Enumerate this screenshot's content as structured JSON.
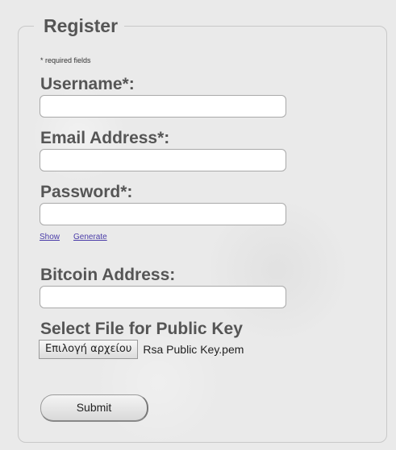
{
  "form": {
    "legend": "Register",
    "required_note": "* required fields",
    "username": {
      "label": "Username*:",
      "value": ""
    },
    "email": {
      "label": "Email Address*:",
      "value": ""
    },
    "password": {
      "label": "Password*:",
      "value": ""
    },
    "password_links": {
      "show": "Show",
      "generate": "Generate"
    },
    "bitcoin": {
      "label": "Bitcoin Address:",
      "value": ""
    },
    "public_key": {
      "label": "Select File for Public Key",
      "button": "Επιλογή αρχείου",
      "file_name": "Rsa Public Key.pem"
    },
    "submit": "Submit"
  },
  "colors": {
    "background": "#eaeaea",
    "label_text": "#555555",
    "link": "#4a3ca8",
    "input_background": "#ffffff"
  }
}
